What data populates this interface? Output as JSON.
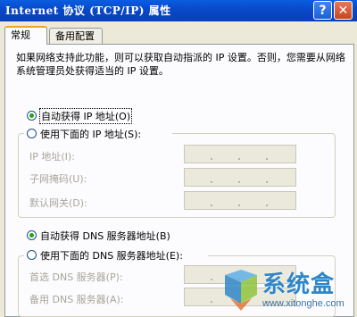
{
  "window": {
    "title": "Internet 协议 (TCP/IP) 属性",
    "help_glyph": "?",
    "close_glyph": "✕"
  },
  "tabs": [
    {
      "label": "常规",
      "active": true
    },
    {
      "label": "备用配置",
      "active": false
    }
  ],
  "intro_text": "如果网络支持此功能，则可以获取自动指派的 IP 设置。否则，您需要从网络系统管理员处获得适当的 IP 设置。",
  "ip": {
    "auto_label": "自动获得 IP 地址(O)",
    "manual_label": "使用下面的 IP 地址(S):",
    "selected": "auto",
    "fields": [
      {
        "label": "IP 地址(I):",
        "value": ""
      },
      {
        "label": "子网掩码(U):",
        "value": ""
      },
      {
        "label": "默认网关(D):",
        "value": ""
      }
    ]
  },
  "dns": {
    "auto_label": "自动获得 DNS 服务器地址(B)",
    "manual_label": "使用下面的 DNS 服务器地址(E):",
    "selected": "auto",
    "fields": [
      {
        "label": "首选 DNS 服务器(P):",
        "value": ""
      },
      {
        "label": "备用 DNS 服务器(A):",
        "value": ""
      }
    ]
  },
  "watermark": {
    "brand": "系统盒",
    "url": "www.xitonghe.com"
  },
  "colors": {
    "titlebar": "#0a52d8",
    "window_bg": "#ece9d8",
    "panel_bg": "#fcfcfe",
    "radio_checked": "#21a121",
    "watermark": "#2f86c8"
  }
}
